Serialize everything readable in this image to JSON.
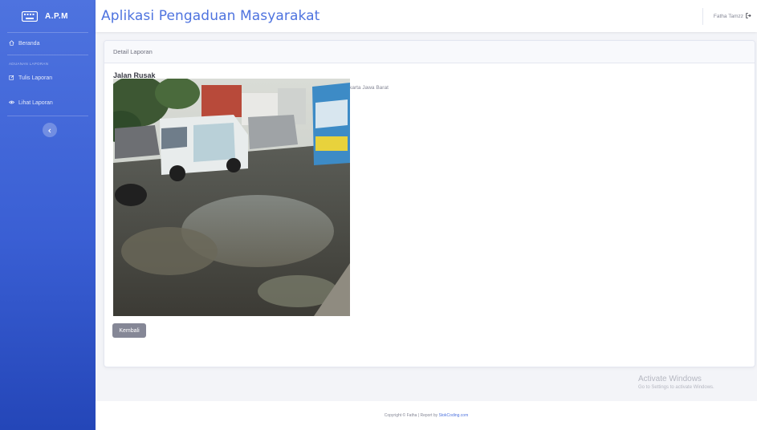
{
  "brand": {
    "name": "A.P.M",
    "icon": "laugh-wink-icon"
  },
  "sidebar": {
    "items": [
      {
        "label": "Beranda",
        "icon": "home-icon"
      }
    ],
    "section_heading": "ADUANAN LAPORAN",
    "section_items": [
      {
        "label": "Tulis Laporan",
        "icon": "edit-icon"
      },
      {
        "label": "Lihat Laporan",
        "icon": "eye-icon"
      }
    ],
    "toggle_icon": "chevron-left-icon"
  },
  "header": {
    "title": "Aplikasi Pengaduan Masyarakat",
    "user_name": "Fatha Tamzz",
    "user_icon": "sign-out-icon"
  },
  "card": {
    "header": "Detail Laporan",
    "title": "Jalan Rusak",
    "description": "Ada Jalanan Rusak didaerah Kami -Condet, Jakarta Timur- Jl no 36 Kemuning Raya Rt 005/03 DKI Jakarta Jawa Barat",
    "button_label": "Kembali"
  },
  "watermark": {
    "title": "Activate Windows",
    "subtitle": "Go to Settings to activate Windows."
  },
  "footer": {
    "text": "Copyright © Fatha | Report by",
    "link": "StokCoding.com"
  },
  "colors": {
    "primary": "#4e73df",
    "sidebar_bottom": "#2446b8",
    "button_secondary": "#858796"
  }
}
